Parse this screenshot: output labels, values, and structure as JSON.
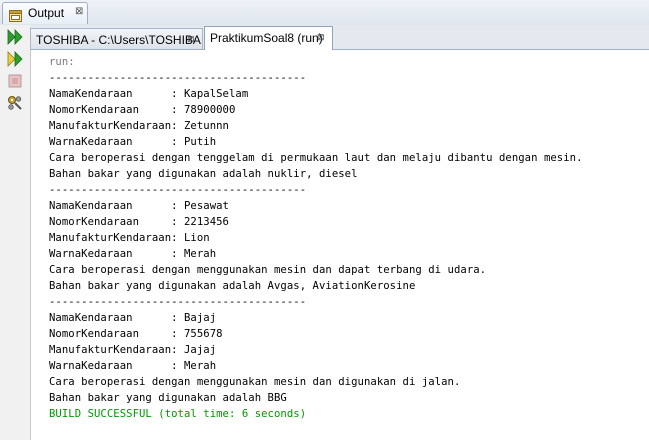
{
  "window": {
    "output_tab_label": "Output",
    "close_glyph": "⊠"
  },
  "tabs": [
    {
      "label": "TOSHIBA - C:\\Users\\TOSHIBA",
      "close": "⊠"
    },
    {
      "label": "PraktikumSoal8 (run)",
      "close": "⊠",
      "active": true
    }
  ],
  "sidebar": {
    "buttons": [
      "rerun-icon",
      "rerun-with-options-icon",
      "stop-icon",
      "settings-icon"
    ]
  },
  "console": {
    "lines": [
      {
        "text": "run:",
        "style": "run"
      },
      {
        "text": "----------------------------------------",
        "style": "normal"
      },
      {
        "text": "NamaKendaraan      : KapalSelam",
        "style": "normal"
      },
      {
        "text": "NomorKendaraan     : 78900000",
        "style": "normal"
      },
      {
        "text": "ManufakturKendaraan: Zetunnn",
        "style": "normal"
      },
      {
        "text": "WarnaKedaraan      : Putih",
        "style": "normal"
      },
      {
        "text": "Cara beroperasi dengan tenggelam di permukaan laut dan melaju dibantu dengan mesin.",
        "style": "normal"
      },
      {
        "text": "Bahan bakar yang digunakan adalah nuklir, diesel",
        "style": "normal"
      },
      {
        "text": "----------------------------------------",
        "style": "normal"
      },
      {
        "text": "NamaKendaraan      : Pesawat",
        "style": "normal"
      },
      {
        "text": "NomorKendaraan     : 2213456",
        "style": "normal"
      },
      {
        "text": "ManufakturKendaraan: Lion",
        "style": "normal"
      },
      {
        "text": "WarnaKedaraan      : Merah",
        "style": "normal"
      },
      {
        "text": "Cara beroperasi dengan menggunakan mesin dan dapat terbang di udara.",
        "style": "normal"
      },
      {
        "text": "Bahan bakar yang digunakan adalah Avgas, AviationKerosine",
        "style": "normal"
      },
      {
        "text": "----------------------------------------",
        "style": "normal"
      },
      {
        "text": "NamaKendaraan      : Bajaj",
        "style": "normal"
      },
      {
        "text": "NomorKendaraan     : 755678",
        "style": "normal"
      },
      {
        "text": "ManufakturKendaraan: Jajaj",
        "style": "normal"
      },
      {
        "text": "WarnaKedaraan      : Merah",
        "style": "normal"
      },
      {
        "text": "Cara beroperasi dengan menggunakan mesin dan digunakan di jalan.",
        "style": "normal"
      },
      {
        "text": "Bahan bakar yang digunakan adalah BBG",
        "style": "normal"
      },
      {
        "text": "BUILD SUCCESSFUL (total time: 6 seconds)",
        "style": "ok"
      }
    ]
  },
  "colors": {
    "run_text": "#7a7a7a",
    "success_text": "#009900",
    "normal_text": "#000000"
  }
}
